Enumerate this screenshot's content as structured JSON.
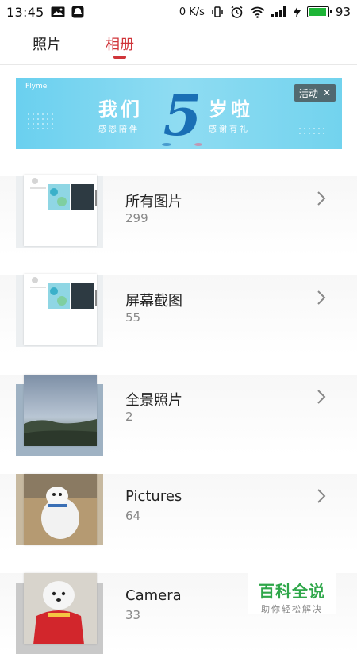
{
  "status_bar": {
    "time": "13:45",
    "net_speed": "0 K/s",
    "battery_percent": "93",
    "battery_level": 0.93,
    "icons": [
      "image-notification-icon",
      "chat-notification-icon",
      "vibrate-icon",
      "alarm-icon",
      "wifi-icon",
      "signal-icon",
      "charging-icon",
      "battery-icon"
    ]
  },
  "tabs": {
    "photos": "照片",
    "albums": "相册",
    "active": "albums",
    "active_color": "#d0353a"
  },
  "banner": {
    "brand": "Flyme",
    "title_left": "我们",
    "title_right": "岁啦",
    "number": "5",
    "subtitle_left": "感恩陪伴",
    "subtitle_right": "感谢有礼",
    "badge_label": "活动",
    "badge_close": "✕"
  },
  "albums": [
    {
      "name": "所有图片",
      "count": "299",
      "thumb": "screenshot-thumb"
    },
    {
      "name": "屏幕截图",
      "count": "55",
      "thumb": "screenshot-thumb"
    },
    {
      "name": "全景照片",
      "count": "2",
      "thumb": "landscape-thumb"
    },
    {
      "name": "Pictures",
      "count": "64",
      "thumb": "dog-thumb"
    },
    {
      "name": "Camera",
      "count": "33",
      "thumb": "dog-red-thumb"
    }
  ],
  "watermark": {
    "title": "百科全说",
    "subtitle": "助你轻松解决"
  }
}
